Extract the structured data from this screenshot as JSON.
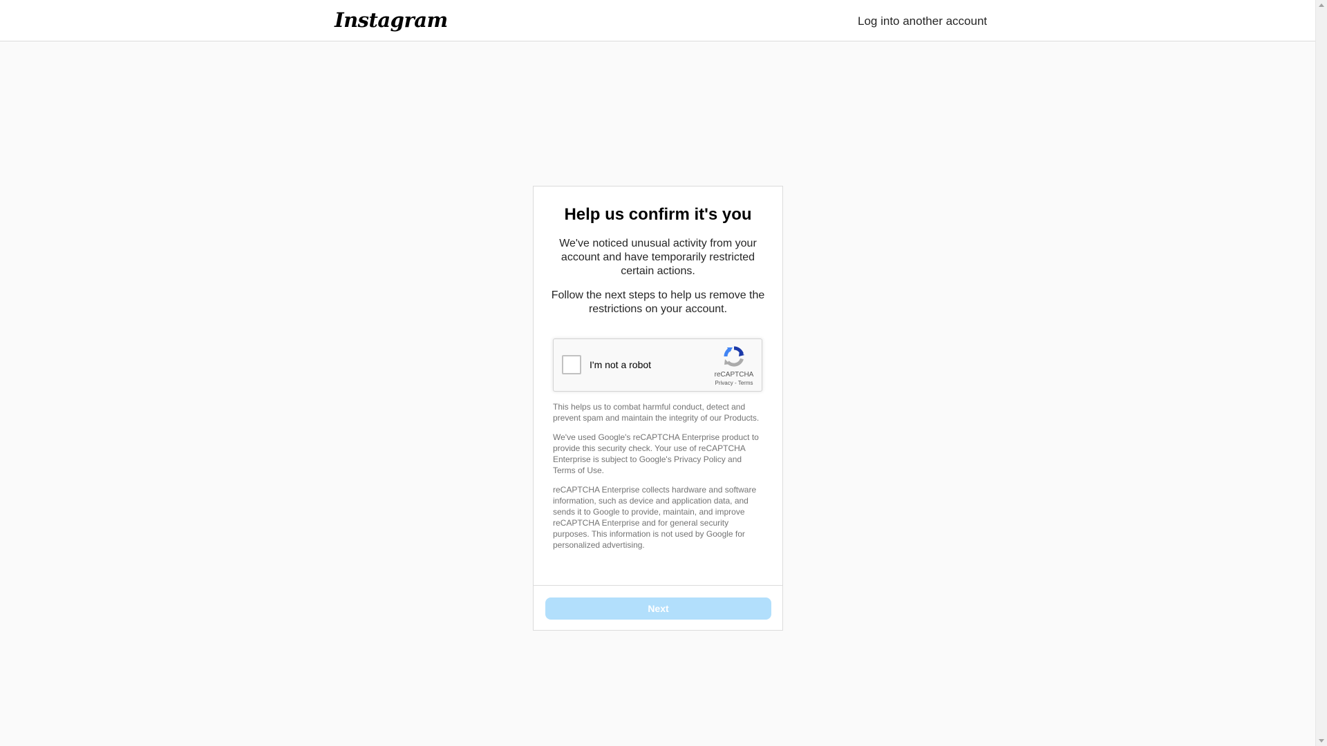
{
  "header": {
    "logo_text": "Instagram",
    "switch_account_label": "Log into another account"
  },
  "card": {
    "title": "Help us confirm it's you",
    "paragraph_1": "We've noticed unusual activity from your account and have temporarily restricted certain actions.",
    "paragraph_2": "Follow the next steps to help us remove the restrictions on your account.",
    "recaptcha": {
      "checkbox_label": "I'm not a robot",
      "checked": false,
      "brand": "reCAPTCHA",
      "privacy_link": "Privacy",
      "separator": " - ",
      "terms_link": "Terms",
      "icon": "recaptcha-logo-icon"
    },
    "notice_1": "This helps us to combat harmful conduct, detect and prevent spam and maintain the integrity of our Products.",
    "notice_2": "We've used Google's reCAPTCHA Enterprise product to provide this security check. Your use of reCAPTCHA Enterprise is subject to Google's Privacy Policy and Terms of Use.",
    "notice_3": "reCAPTCHA Enterprise collects hardware and software information, such as device and application data, and sends it to Google to provide, maintain, and improve reCAPTCHA Enterprise and for general security purposes. This information is not used by Google for personalized advertising.",
    "next_button_label": "Next",
    "next_button_enabled": false
  },
  "colors": {
    "background": "#fafafa",
    "card_border": "#dbdbdb",
    "button_disabled": "#b2dffc",
    "secondary_text": "#737373"
  }
}
